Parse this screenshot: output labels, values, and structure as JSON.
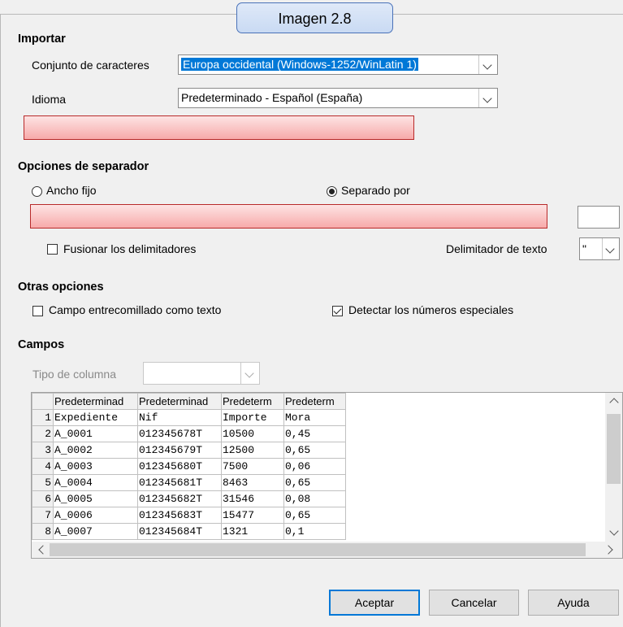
{
  "callout": "Imagen 2.8",
  "importar": {
    "heading": "Importar",
    "charset_label": "Conjunto de caracteres",
    "charset_value": "Europa occidental (Windows-1252/WinLatin 1)",
    "idioma_label": "Idioma",
    "idioma_value": "Predeterminado - Español (España)"
  },
  "separador": {
    "heading": "Opciones de separador",
    "ancho_fijo": "Ancho fijo",
    "separado_por": "Separado por",
    "fusionar": "Fusionar los delimitadores",
    "delimitador_label": "Delimitador de texto",
    "delimitador_value": "\""
  },
  "otras": {
    "heading": "Otras opciones",
    "campo_entrecomillado": "Campo entrecomillado como texto",
    "detectar": "Detectar los números especiales"
  },
  "campos": {
    "heading": "Campos",
    "tipo_label": "Tipo de columna",
    "headers": [
      "Predeterminad",
      "Predeterminad",
      "Predeterm",
      "Predeterm"
    ],
    "rows": [
      [
        "1",
        "Expediente",
        "Nif",
        "Importe",
        "Mora"
      ],
      [
        "2",
        "A_0001",
        "012345678T",
        "10500",
        "0,45"
      ],
      [
        "3",
        "A_0002",
        "012345679T",
        "12500",
        "0,65"
      ],
      [
        "4",
        "A_0003",
        "012345680T",
        "7500",
        "0,06"
      ],
      [
        "5",
        "A_0004",
        "012345681T",
        "8463",
        "0,65"
      ],
      [
        "6",
        "A_0005",
        "012345682T",
        "31546",
        "0,08"
      ],
      [
        "7",
        "A_0006",
        "012345683T",
        "15477",
        "0,65"
      ],
      [
        "8",
        "A_0007",
        "012345684T",
        "1321",
        "0,1"
      ]
    ]
  },
  "buttons": {
    "aceptar": "Aceptar",
    "cancelar": "Cancelar",
    "ayuda": "Ayuda"
  },
  "colors": {
    "accent": "#0078d7",
    "highlight_red": "#f7aaaa",
    "callout_border": "#4a72b8"
  }
}
